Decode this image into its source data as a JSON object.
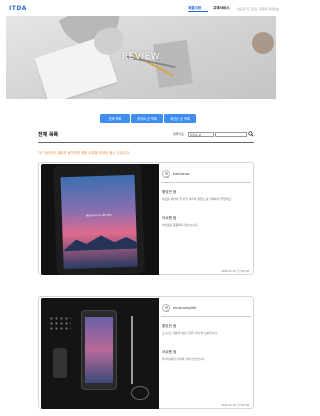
{
  "header": {
    "logo": "ITDA",
    "nav": [
      {
        "label": "제품리뷰",
        "state": "active"
      },
      {
        "label": "고객서비스",
        "state": "bold"
      },
      {
        "label": "새로운 리그인한",
        "state": "light"
      },
      {
        "label": "회원의 회원정보",
        "state": "light"
      }
    ]
  },
  "hero": {
    "title": "REVIEW"
  },
  "filters": [
    "전체 목록",
    "좋아요 순 목록",
    "최신순 순 목록"
  ],
  "list": {
    "title": "전체 목록",
    "sort_label": "정렬기준",
    "sort_value": "최신순 순",
    "search_value": "",
    "notice": "다! 이런이의 새로운 솔직하면 해당 리뷰를 리셔야 볼수 있습니다."
  },
  "reviews": [
    {
      "username": "kimhanzo",
      "good_heading": "좋았던 점",
      "good_text": "새로운 화면이 좋 편한 리이의 범행도 참 만족하서 좋았어요.",
      "bad_heading": "아쉬웠 점",
      "bad_text": "아쉬웠던 좀좀하지 않는습니다.",
      "date": "2020.12.18 오전10:38",
      "image_text": "Welcome to Wonder"
    },
    {
      "username": "musicismylife",
      "good_heading": "좋았던 점",
      "good_text": "오 pc로 사용하기보다 좋은 나이 방 모처합니다.",
      "bad_heading": "아쉬웠 점",
      "bad_text": "약 아쉬운편 부분의 같이 많습습니다.",
      "date": "2020.12.18 오전10:38"
    }
  ],
  "icons": {
    "search": "search-icon",
    "avatar": "user-avatar-icon"
  },
  "colors": {
    "accent": "#2a6cd6",
    "button": "#3e8ef0",
    "notice": "#e8893b"
  }
}
